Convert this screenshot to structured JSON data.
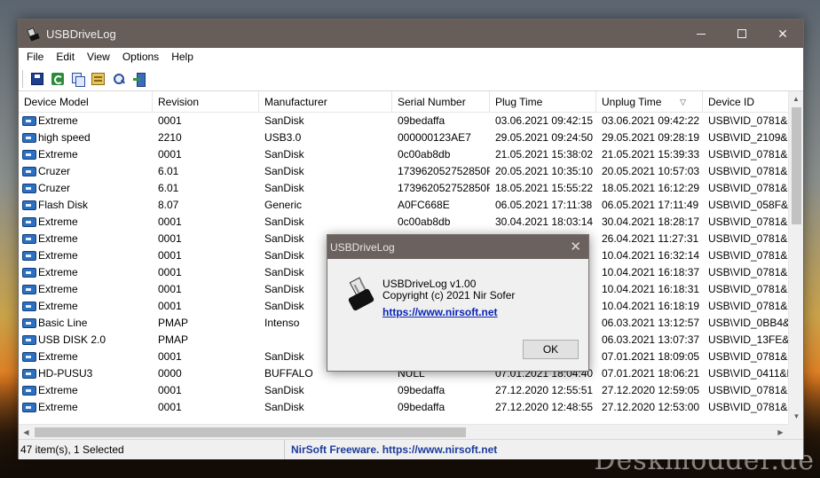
{
  "window": {
    "title": "USBDriveLog",
    "minimize_glyph": "",
    "maximize_glyph": "",
    "close_glyph": "✕"
  },
  "menu": {
    "items": [
      "File",
      "Edit",
      "View",
      "Options",
      "Help"
    ]
  },
  "toolbar": {
    "icons": [
      "save-icon",
      "refresh-icon",
      "copy-icon",
      "properties-icon",
      "find-icon",
      "exit-icon"
    ]
  },
  "list": {
    "columns": [
      "Device Model",
      "Revision",
      "Manufacturer",
      "Serial Number",
      "Plug Time",
      "Unplug Time",
      "Device ID"
    ],
    "sorted_column": "Unplug Time",
    "rows": [
      [
        "Extreme",
        "0001",
        "SanDisk",
        "09bedaffa",
        "03.06.2021 09:42:15",
        "03.06.2021 09:42:22",
        "USB\\VID_0781&P"
      ],
      [
        "high speed",
        "2210",
        "USB3.0",
        "000000123AE7",
        "29.05.2021 09:24:50",
        "29.05.2021 09:28:19",
        "USB\\VID_2109&P"
      ],
      [
        "Extreme",
        "0001",
        "SanDisk",
        "0c00ab8db",
        "21.05.2021 15:38:02",
        "21.05.2021 15:39:33",
        "USB\\VID_0781&P"
      ],
      [
        "Cruzer",
        "6.01",
        "SanDisk",
        "173962052752850F",
        "20.05.2021 10:35:10",
        "20.05.2021 10:57:03",
        "USB\\VID_0781&P"
      ],
      [
        "Cruzer",
        "6.01",
        "SanDisk",
        "173962052752850F",
        "18.05.2021 15:55:22",
        "18.05.2021 16:12:29",
        "USB\\VID_0781&P"
      ],
      [
        "Flash Disk",
        "8.07",
        "Generic",
        "A0FC668E",
        "06.05.2021 17:11:38",
        "06.05.2021 17:11:49",
        "USB\\VID_058F&P"
      ],
      [
        "Extreme",
        "0001",
        "SanDisk",
        "0c00ab8db",
        "30.04.2021 18:03:14",
        "30.04.2021 18:28:17",
        "USB\\VID_0781&P"
      ],
      [
        "Extreme",
        "0001",
        "SanDisk",
        "",
        "",
        "26.04.2021 11:27:31",
        "USB\\VID_0781&P"
      ],
      [
        "Extreme",
        "0001",
        "SanDisk",
        "",
        "",
        "10.04.2021 16:32:14",
        "USB\\VID_0781&P"
      ],
      [
        "Extreme",
        "0001",
        "SanDisk",
        "",
        "",
        "10.04.2021 16:18:37",
        "USB\\VID_0781&P"
      ],
      [
        "Extreme",
        "0001",
        "SanDisk",
        "",
        "",
        "10.04.2021 16:18:31",
        "USB\\VID_0781&P"
      ],
      [
        "Extreme",
        "0001",
        "SanDisk",
        "",
        "",
        "10.04.2021 16:18:19",
        "USB\\VID_0781&P"
      ],
      [
        "Basic Line",
        "PMAP",
        "Intenso",
        "",
        "",
        "06.03.2021 13:12:57",
        "USB\\VID_0BB4&P"
      ],
      [
        "USB DISK 2.0",
        "PMAP",
        "",
        "",
        "",
        "06.03.2021 13:07:37",
        "USB\\VID_13FE&P"
      ],
      [
        "Extreme",
        "0001",
        "SanDisk",
        "",
        "",
        "07.01.2021 18:09:05",
        "USB\\VID_0781&P"
      ],
      [
        "HD-PUSU3",
        "0000",
        "BUFFALO",
        "NULL",
        "07.01.2021 18:04:40",
        "07.01.2021 18:06:21",
        "USB\\VID_0411&P"
      ],
      [
        "Extreme",
        "0001",
        "SanDisk",
        "09bedaffa",
        "27.12.2020 12:55:51",
        "27.12.2020 12:59:05",
        "USB\\VID_0781&P"
      ],
      [
        "Extreme",
        "0001",
        "SanDisk",
        "09bedaffa",
        "27.12.2020 12:48:55",
        "27.12.2020 12:53:00",
        "USB\\VID_0781&P"
      ]
    ]
  },
  "status": {
    "count": "47 item(s), 1 Selected",
    "credit": "NirSoft Freeware. https://www.nirsoft.net"
  },
  "about_dialog": {
    "title": "USBDriveLog",
    "close_glyph": "✕",
    "version": "USBDriveLog v1.00",
    "copyright": "Copyright (c) 2021 Nir Sofer",
    "link": "https://www.nirsoft.net",
    "ok_label": "OK"
  },
  "watermark": "Deskmodder.de"
}
